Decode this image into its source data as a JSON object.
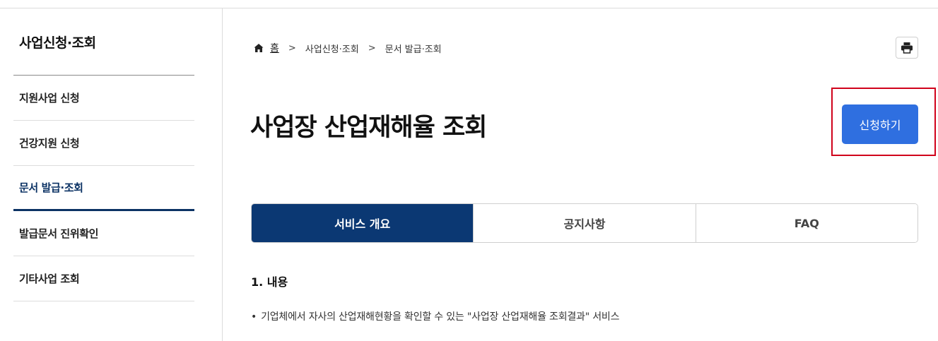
{
  "sidebar": {
    "title": "사업신청·조회",
    "items": [
      {
        "label": "지원사업 신청",
        "active": false
      },
      {
        "label": "건강지원 신청",
        "active": false
      },
      {
        "label": "문서 발급·조회",
        "active": true
      },
      {
        "label": "발급문서 진위확인",
        "active": false
      },
      {
        "label": "기타사업 조회",
        "active": false
      }
    ]
  },
  "breadcrumb": {
    "home": "홈",
    "level1": "사업신청·조회",
    "level2": "문서 발급·조회",
    "separator": ">"
  },
  "page": {
    "title": "사업장 산업재해율 조회",
    "apply_label": "신청하기"
  },
  "tabs": [
    {
      "label": "서비스 개요",
      "active": true
    },
    {
      "label": "공지사항",
      "active": false
    },
    {
      "label": "FAQ",
      "active": false
    }
  ],
  "content": {
    "heading": "1. 내용",
    "bullet_mark": "•",
    "bullet": "기업체에서 자사의 산업재해현황을 확인할 수 있는 \"사업장 산업재해율 조회결과\" 서비스"
  },
  "icons": {
    "home": "home-icon",
    "print": "printer-icon"
  },
  "colors": {
    "primary_navy": "#0b3873",
    "apply_blue": "#2f6fe0",
    "highlight_red": "#d0021b"
  }
}
